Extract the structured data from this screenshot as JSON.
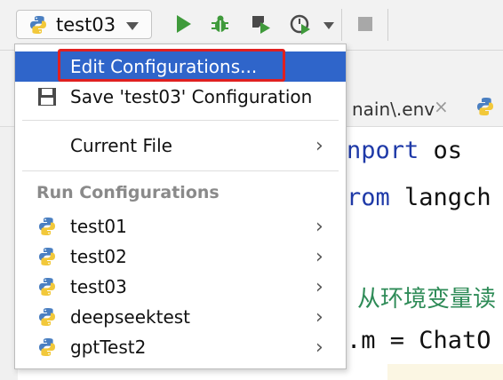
{
  "toolbar": {
    "run_config_selected": "test03",
    "icons": [
      "python-icon",
      "run-icon",
      "debug-icon",
      "coverage-icon",
      "profile-icon",
      "stop-icon"
    ]
  },
  "editor": {
    "tab_label": "nain\\.env",
    "tab_close": "×",
    "code": {
      "line1_kw": "nport",
      "line1_rest": " os",
      "line2_kw": "rom",
      "line2_rest": " langch",
      "line3_comment": "从环境变量读",
      "line4": ".m = ChatO"
    }
  },
  "menu": {
    "edit_configurations": "Edit Configurations...",
    "save_configuration": "Save 'test03' Configuration",
    "current_file": "Current File",
    "run_configurations_header": "Run Configurations",
    "run_configurations": [
      "test01",
      "test02",
      "test03",
      "deepseektest",
      "gptTest2"
    ],
    "chevron": "›"
  },
  "colors": {
    "selection": "#2f65ca",
    "highlight_border": "#e02020",
    "run_green": "#3f9a3b",
    "keyword_blue": "#1f3aa8",
    "comment_green": "#2e8b57"
  }
}
